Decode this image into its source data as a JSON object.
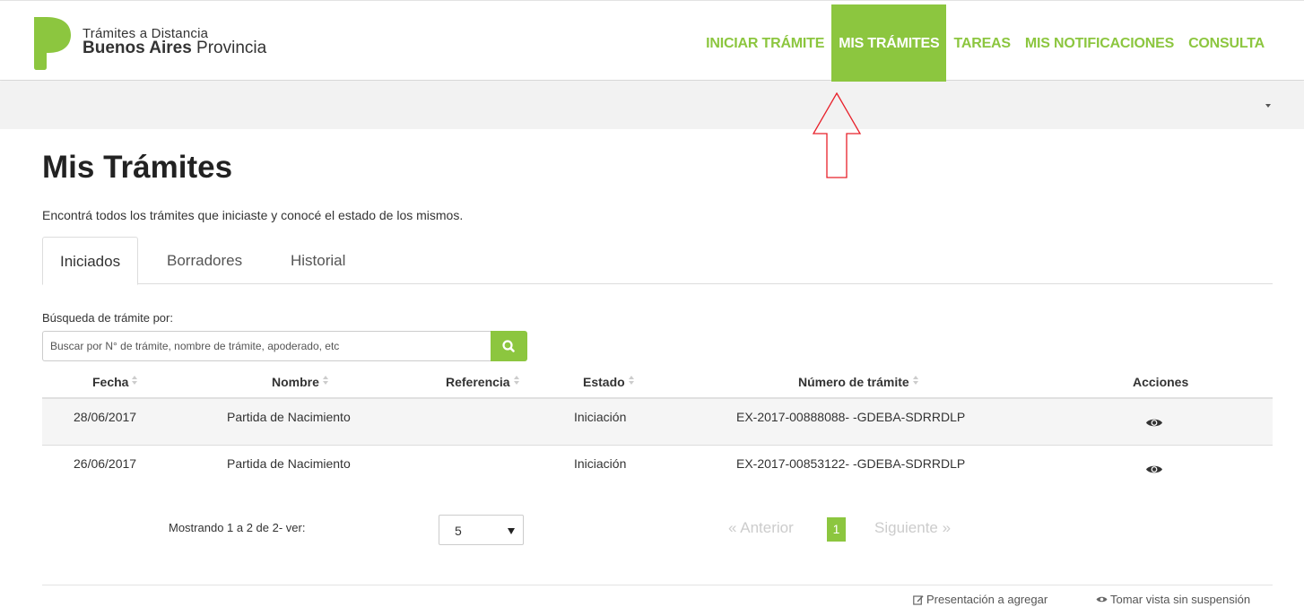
{
  "brand": {
    "line1": "Trámites a Distancia",
    "line2_bold": "Buenos Aires",
    "line2_rest": " Provincia",
    "logo_color": "#8cc63f"
  },
  "nav": {
    "items": [
      {
        "label": "INICIAR TRÁMITE"
      },
      {
        "label": "MIS TRÁMITES",
        "active": true
      },
      {
        "label": "TAREAS"
      },
      {
        "label": "MIS NOTIFICACIONES"
      },
      {
        "label": "CONSULTA"
      }
    ]
  },
  "page": {
    "title": "Mis Trámites",
    "subtitle": "Encontrá todos los trámites que iniciaste y conocé el estado de los mismos."
  },
  "tabs": [
    {
      "label": "Iniciados",
      "active": true
    },
    {
      "label": "Borradores"
    },
    {
      "label": "Historial"
    }
  ],
  "search": {
    "label": "Búsqueda de trámite por:",
    "placeholder": "Buscar por N° de trámite, nombre de trámite, apoderado, etc",
    "button_icon": "search-icon"
  },
  "table": {
    "columns": [
      "Fecha",
      "Nombre",
      "Referencia",
      "Estado",
      "Número de trámite",
      "Acciones"
    ],
    "rows": [
      {
        "fecha": "28/06/2017",
        "nombre": "Partida de Nacimiento",
        "referencia": "",
        "estado": "Iniciación",
        "numero": "EX-2017-00888088- -GDEBA-SDRRDLP",
        "accion_icon": "eye-icon"
      },
      {
        "fecha": "26/06/2017",
        "nombre": "Partida de Nacimiento",
        "referencia": "",
        "estado": "Iniciación",
        "numero": "EX-2017-00853122- -GDEBA-SDRRDLP",
        "accion_icon": "eye-icon"
      }
    ]
  },
  "pagination": {
    "showing": "Mostrando 1 a 2 de 2- ver:",
    "page_size": "5",
    "prev": "« Anterior",
    "current": "1",
    "next": "Siguiente »"
  },
  "footer": {
    "link1": "Presentación a agregar",
    "link2": "Tomar vista sin suspensión"
  },
  "colors": {
    "accent": "#8cc63f",
    "annotation_arrow": "#e8202a"
  }
}
